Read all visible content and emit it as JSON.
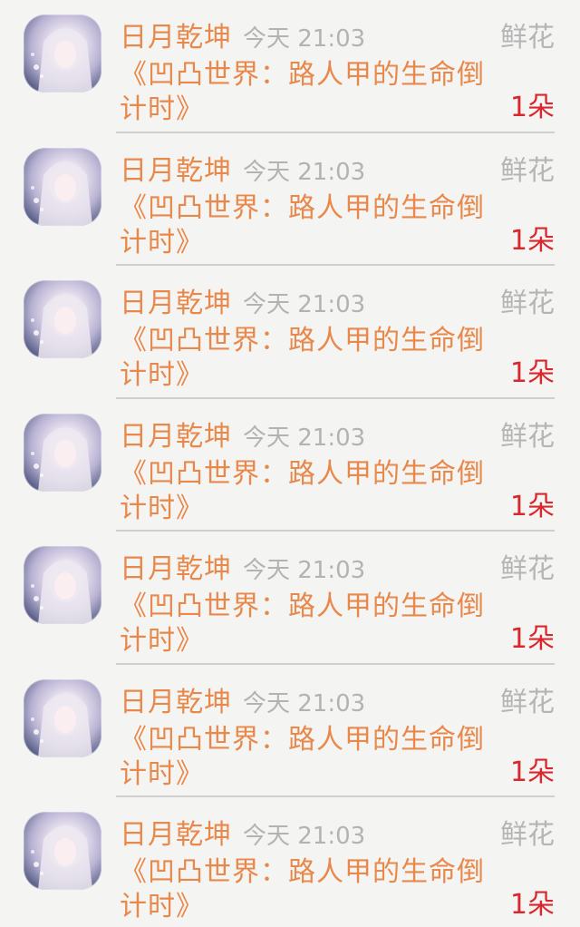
{
  "items": [
    {
      "name": "日月乾坤",
      "time": "今天 21:03",
      "book": "《凹凸世界：路人甲的生命倒计时》",
      "gift_type": "鲜花",
      "gift_count": "1朵"
    },
    {
      "name": "日月乾坤",
      "time": "今天 21:03",
      "book": "《凹凸世界：路人甲的生命倒计时》",
      "gift_type": "鲜花",
      "gift_count": "1朵"
    },
    {
      "name": "日月乾坤",
      "time": "今天 21:03",
      "book": "《凹凸世界：路人甲的生命倒计时》",
      "gift_type": "鲜花",
      "gift_count": "1朵"
    },
    {
      "name": "日月乾坤",
      "time": "今天 21:03",
      "book": "《凹凸世界：路人甲的生命倒计时》",
      "gift_type": "鲜花",
      "gift_count": "1朵"
    },
    {
      "name": "日月乾坤",
      "time": "今天 21:03",
      "book": "《凹凸世界：路人甲的生命倒计时》",
      "gift_type": "鲜花",
      "gift_count": "1朵"
    },
    {
      "name": "日月乾坤",
      "time": "今天 21:03",
      "book": "《凹凸世界：路人甲的生命倒计时》",
      "gift_type": "鲜花",
      "gift_count": "1朵"
    },
    {
      "name": "日月乾坤",
      "time": "今天 21:03",
      "book": "《凹凸世界：路人甲的生命倒计时》",
      "gift_type": "鲜花",
      "gift_count": "1朵"
    }
  ],
  "colors": {
    "name": "#e8884a",
    "book": "#e8884a",
    "time": "#b3b3b3",
    "gift_type": "#b5b5b5",
    "gift_count": "#d8282e",
    "background": "#f4f4f2"
  },
  "icons": {
    "avatar": "avatar-icon"
  }
}
